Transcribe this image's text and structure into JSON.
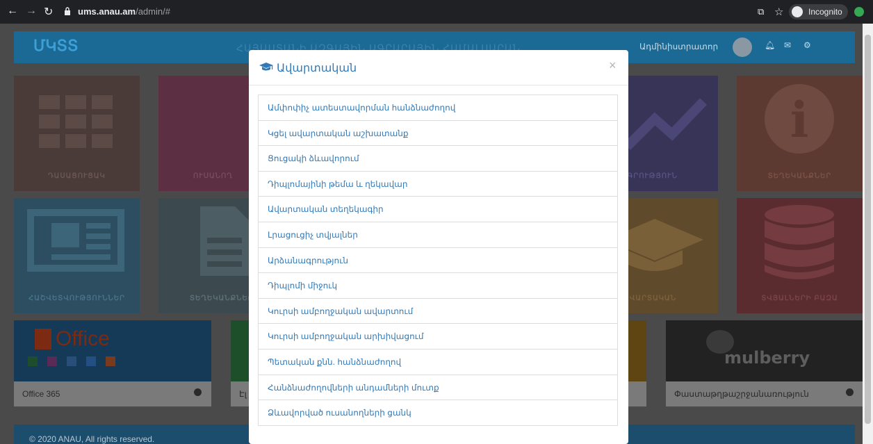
{
  "browser": {
    "url_host": "ums.anau.am",
    "url_path": "/admin/#",
    "incognito_label": "Incognito"
  },
  "header": {
    "logo": "ՄԿՏՏ",
    "university": "ՀԱՅԱՍՏԱՆԻ ԱԶԳԱՅԻՆ ԱԳՐԱՐԱՅԻՆ ՀԱՄԱԼՍԱՐԱՆ",
    "user_role": "Ադմինիստրատոր"
  },
  "tiles": [
    {
      "label": "ԴԱՍԱՑՈՒՑԱԿ",
      "color": "#4b3b38"
    },
    {
      "label": "ՈՒՍԱՆՈՂ",
      "color": "#5c2f42"
    },
    {
      "label": "ՎԻՃԱԿԱԳՐՈՒԹՅՈՒՆ",
      "color": "#373457"
    },
    {
      "label": "ՏԵՂԵԿԱՆՔՆԵՐ",
      "color": "#5c3a31"
    },
    {
      "label": "ՀԱՇՎԵՏՎՈՒԹՅՈՒՆՆԵՐ",
      "color": "#2c4e60"
    },
    {
      "label": "ՏԵՂԵԿԱՆՔՆԵՐ",
      "color": "#3c4a4f"
    },
    {
      "label": "ԱՎԱՐՏԱԿԱՆ",
      "color": "#5f4a2c"
    },
    {
      "label": "ՏՎՅԱԼՆԵՐԻ ԲԱԶԱ",
      "color": "#5a2c2f"
    }
  ],
  "wide_tiles": [
    {
      "label": "Office 365"
    },
    {
      "label": "Էլ"
    },
    {
      "label": "Փաստաթղթաշրջանառություն"
    }
  ],
  "office_logo_text": "Office",
  "mulberry_logo_text": "mulberry",
  "footer_text": "© 2020 ANAU, All rights reserved.",
  "modal": {
    "title": "Ավարտական",
    "close_glyph": "×",
    "items": [
      "Ամփոփիչ ատեստավորման հանձնաժողով",
      "Կցել ավարտական աշխատանք",
      "Ցուցակի ձևավորում",
      "Դիպլոմայինի թեմա և ղեկավար",
      "Ավարտական տեղեկագիր",
      "Լրացուցիչ տվյալներ",
      "Արձանագրություն",
      "Դիպլոմի միջուկ",
      "Կուրսի ամբողջական ավարտում",
      "Կուրսի ամբողջական արխիվացում",
      "Պետական քնն. հանձնաժողով",
      "Հանձնաժողովների անդամների մուտք",
      "Ձևավորված ուսանողների ցանկ"
    ]
  },
  "colors": {
    "accent": "#337ab7",
    "topbar": "#1b6a96",
    "footer": "#1c4d6c"
  }
}
